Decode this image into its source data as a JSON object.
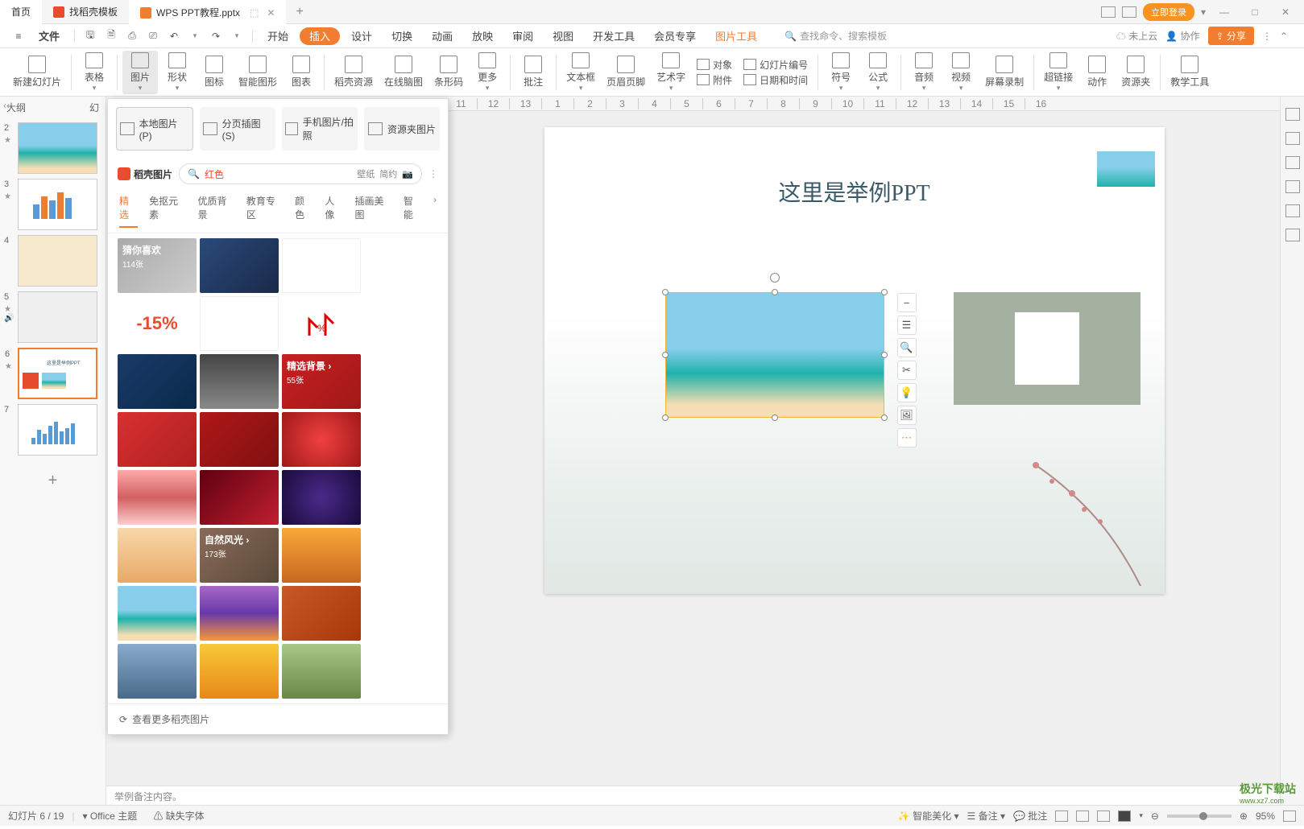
{
  "title_tabs": {
    "home": "首页",
    "templates": "找稻壳模板",
    "document": "WPS PPT教程.pptx"
  },
  "login": "立即登录",
  "file_menu": "文件",
  "menu_tabs": {
    "start": "开始",
    "insert": "插入",
    "design": "设计",
    "transition": "切换",
    "animation": "动画",
    "slideshow": "放映",
    "review": "审阅",
    "view": "视图",
    "devtools": "开发工具",
    "member": "会员专享",
    "context": "图片工具"
  },
  "search_placeholder": "查找命令、搜索模板",
  "menu_right": {
    "cloud": "未上云",
    "collab": "协作",
    "share": "分享"
  },
  "ribbon": {
    "new_slide": "新建幻灯片",
    "table": "表格",
    "picture": "图片",
    "shape": "形状",
    "icon": "图标",
    "smartart": "智能图形",
    "chart": "图表",
    "docer": "稻壳资源",
    "mindmap": "在线脑图",
    "barcode": "条形码",
    "more": "更多",
    "comment": "批注",
    "textbox": "文本框",
    "header_footer": "页眉页脚",
    "wordart": "艺术字",
    "object": "对象",
    "attachment": "附件",
    "slide_number": "幻灯片编号",
    "datetime": "日期和时间",
    "symbol": "符号",
    "equation": "公式",
    "audio": "音频",
    "video": "视频",
    "screen_record": "屏幕录制",
    "hyperlink": "超链接",
    "action": "动作",
    "resource": "资源夹",
    "teaching": "教学工具"
  },
  "thumb_tabs": {
    "outline": "大纲",
    "slides": "幻"
  },
  "slides": [
    2,
    3,
    4,
    5,
    6,
    7
  ],
  "img_dropdown": {
    "local": "本地图片(P)",
    "paged": "分页插图(S)",
    "mobile": "手机图片/拍照",
    "folder": "资源夹图片",
    "brand": "稻壳图片",
    "search_value": "红色",
    "wallpaper": "壁纸",
    "simple": "简约",
    "cats": [
      "精选",
      "免抠元素",
      "优质背景",
      "教育专区",
      "颜色",
      "人像",
      "插画美图",
      "智能"
    ],
    "block1_title": "猜你喜欢",
    "block1_sub": "114张",
    "block2_title": "精选背景 ›",
    "block2_sub": "55张",
    "block3_title": "自然风光 ›",
    "block3_sub": "173张",
    "footer": "查看更多稻壳图片"
  },
  "slide_title": "这里是举例PPT",
  "notes_placeholder": "举例备注内容。",
  "status": {
    "slide_pos": "幻灯片 6 / 19",
    "theme": "Office 主题",
    "missing_font": "缺失字体",
    "beautify": "智能美化",
    "notes": "备注",
    "comments": "批注",
    "zoom": "95%"
  },
  "watermark": {
    "brand": "极光下载站",
    "url": "www.xz7.com"
  }
}
